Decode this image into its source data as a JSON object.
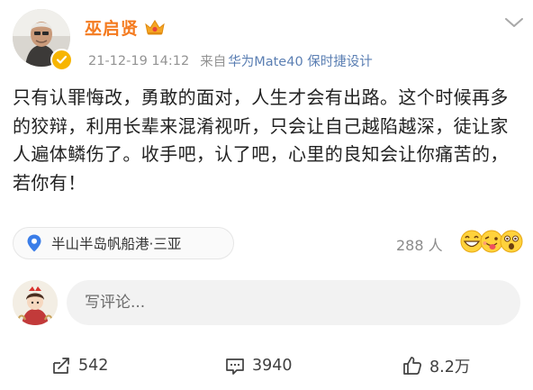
{
  "post": {
    "author": {
      "name": "巫启贤"
    },
    "meta": {
      "time": "21-12-19 14:12",
      "source_prefix": "来自",
      "source": "华为Mate40 保时捷设计"
    },
    "text": "只有认罪悔改，勇敢的面对，人生才会有出路。这个时候再多的狡辩，利用长辈来混淆视听，只会让自己越陷越深，徒让家人遍体鳞伤了。收手吧，认了吧，心里的良知会让你痛苦的，若你有！",
    "location": "半山半岛帆船港·三亚",
    "reactions": {
      "count_label": "288 人",
      "emojis": [
        "grin-emoji",
        "tongue-wink-emoji",
        "shocked-emoji"
      ]
    },
    "comment_box": {
      "placeholder": "写评论..."
    },
    "actions": {
      "repost_count": "542",
      "comment_count": "3940",
      "like_count": "8.2万"
    }
  },
  "colors": {
    "username": "#f47b20",
    "source_link": "#5b7fb3",
    "meta_gray": "#939393",
    "location_pin": "#3a7de8"
  },
  "icons": {
    "more": "chevron-down-icon",
    "verified": "verified-badge-icon",
    "member": "crown-icon",
    "location": "map-pin-icon",
    "repost": "repost-icon",
    "comment": "comment-icon",
    "like": "thumbs-up-icon"
  }
}
